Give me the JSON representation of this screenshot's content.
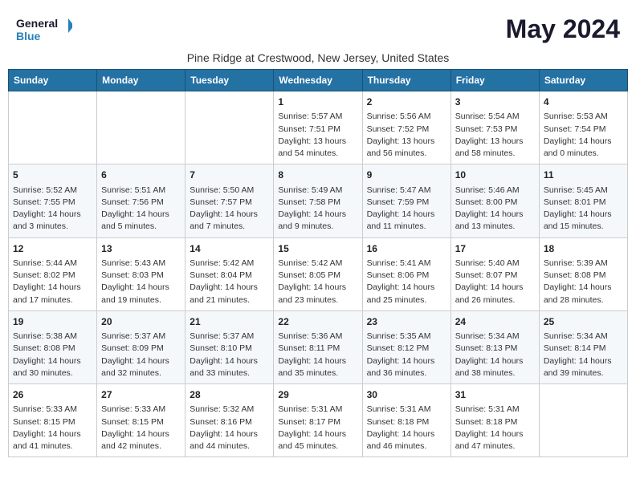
{
  "logo": {
    "line1": "General",
    "line2": "Blue"
  },
  "title": "May 2024",
  "subtitle": "Pine Ridge at Crestwood, New Jersey, United States",
  "weekdays": [
    "Sunday",
    "Monday",
    "Tuesday",
    "Wednesday",
    "Thursday",
    "Friday",
    "Saturday"
  ],
  "weeks": [
    [
      {
        "day": "",
        "content": ""
      },
      {
        "day": "",
        "content": ""
      },
      {
        "day": "",
        "content": ""
      },
      {
        "day": "1",
        "content": "Sunrise: 5:57 AM\nSunset: 7:51 PM\nDaylight: 13 hours\nand 54 minutes."
      },
      {
        "day": "2",
        "content": "Sunrise: 5:56 AM\nSunset: 7:52 PM\nDaylight: 13 hours\nand 56 minutes."
      },
      {
        "day": "3",
        "content": "Sunrise: 5:54 AM\nSunset: 7:53 PM\nDaylight: 13 hours\nand 58 minutes."
      },
      {
        "day": "4",
        "content": "Sunrise: 5:53 AM\nSunset: 7:54 PM\nDaylight: 14 hours\nand 0 minutes."
      }
    ],
    [
      {
        "day": "5",
        "content": "Sunrise: 5:52 AM\nSunset: 7:55 PM\nDaylight: 14 hours\nand 3 minutes."
      },
      {
        "day": "6",
        "content": "Sunrise: 5:51 AM\nSunset: 7:56 PM\nDaylight: 14 hours\nand 5 minutes."
      },
      {
        "day": "7",
        "content": "Sunrise: 5:50 AM\nSunset: 7:57 PM\nDaylight: 14 hours\nand 7 minutes."
      },
      {
        "day": "8",
        "content": "Sunrise: 5:49 AM\nSunset: 7:58 PM\nDaylight: 14 hours\nand 9 minutes."
      },
      {
        "day": "9",
        "content": "Sunrise: 5:47 AM\nSunset: 7:59 PM\nDaylight: 14 hours\nand 11 minutes."
      },
      {
        "day": "10",
        "content": "Sunrise: 5:46 AM\nSunset: 8:00 PM\nDaylight: 14 hours\nand 13 minutes."
      },
      {
        "day": "11",
        "content": "Sunrise: 5:45 AM\nSunset: 8:01 PM\nDaylight: 14 hours\nand 15 minutes."
      }
    ],
    [
      {
        "day": "12",
        "content": "Sunrise: 5:44 AM\nSunset: 8:02 PM\nDaylight: 14 hours\nand 17 minutes."
      },
      {
        "day": "13",
        "content": "Sunrise: 5:43 AM\nSunset: 8:03 PM\nDaylight: 14 hours\nand 19 minutes."
      },
      {
        "day": "14",
        "content": "Sunrise: 5:42 AM\nSunset: 8:04 PM\nDaylight: 14 hours\nand 21 minutes."
      },
      {
        "day": "15",
        "content": "Sunrise: 5:42 AM\nSunset: 8:05 PM\nDaylight: 14 hours\nand 23 minutes."
      },
      {
        "day": "16",
        "content": "Sunrise: 5:41 AM\nSunset: 8:06 PM\nDaylight: 14 hours\nand 25 minutes."
      },
      {
        "day": "17",
        "content": "Sunrise: 5:40 AM\nSunset: 8:07 PM\nDaylight: 14 hours\nand 26 minutes."
      },
      {
        "day": "18",
        "content": "Sunrise: 5:39 AM\nSunset: 8:08 PM\nDaylight: 14 hours\nand 28 minutes."
      }
    ],
    [
      {
        "day": "19",
        "content": "Sunrise: 5:38 AM\nSunset: 8:08 PM\nDaylight: 14 hours\nand 30 minutes."
      },
      {
        "day": "20",
        "content": "Sunrise: 5:37 AM\nSunset: 8:09 PM\nDaylight: 14 hours\nand 32 minutes."
      },
      {
        "day": "21",
        "content": "Sunrise: 5:37 AM\nSunset: 8:10 PM\nDaylight: 14 hours\nand 33 minutes."
      },
      {
        "day": "22",
        "content": "Sunrise: 5:36 AM\nSunset: 8:11 PM\nDaylight: 14 hours\nand 35 minutes."
      },
      {
        "day": "23",
        "content": "Sunrise: 5:35 AM\nSunset: 8:12 PM\nDaylight: 14 hours\nand 36 minutes."
      },
      {
        "day": "24",
        "content": "Sunrise: 5:34 AM\nSunset: 8:13 PM\nDaylight: 14 hours\nand 38 minutes."
      },
      {
        "day": "25",
        "content": "Sunrise: 5:34 AM\nSunset: 8:14 PM\nDaylight: 14 hours\nand 39 minutes."
      }
    ],
    [
      {
        "day": "26",
        "content": "Sunrise: 5:33 AM\nSunset: 8:15 PM\nDaylight: 14 hours\nand 41 minutes."
      },
      {
        "day": "27",
        "content": "Sunrise: 5:33 AM\nSunset: 8:15 PM\nDaylight: 14 hours\nand 42 minutes."
      },
      {
        "day": "28",
        "content": "Sunrise: 5:32 AM\nSunset: 8:16 PM\nDaylight: 14 hours\nand 44 minutes."
      },
      {
        "day": "29",
        "content": "Sunrise: 5:31 AM\nSunset: 8:17 PM\nDaylight: 14 hours\nand 45 minutes."
      },
      {
        "day": "30",
        "content": "Sunrise: 5:31 AM\nSunset: 8:18 PM\nDaylight: 14 hours\nand 46 minutes."
      },
      {
        "day": "31",
        "content": "Sunrise: 5:31 AM\nSunset: 8:18 PM\nDaylight: 14 hours\nand 47 minutes."
      },
      {
        "day": "",
        "content": ""
      }
    ]
  ]
}
